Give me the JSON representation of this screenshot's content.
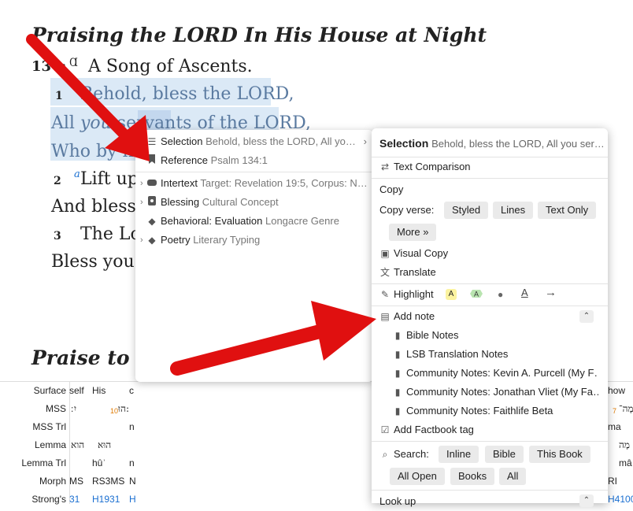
{
  "bible": {
    "heading1": "Praising the LORD In His House at Night",
    "ps_num": "134:",
    "ps_title_prefix": "Ɑ",
    "ps_title": "A Song of Ascents.",
    "v1_num": "1",
    "v1_line1": "Behold, bless the LORD,",
    "v1_line2a": "All ",
    "v1_line2b": "you",
    "v1_line2c": " servants of the LORD,",
    "v1_line3": "Who by night",
    "v2_num": "2",
    "v2_note": "a",
    "v2_line1": "Lift up",
    "v2_line2": "And bless t",
    "v3_num": "3",
    "v3_line1": "The Lo",
    "v3_line2": "Bless you fr",
    "heading2": "Praise to Go"
  },
  "interlinear": {
    "rows": [
      {
        "label": "Surface",
        "c1": "self",
        "c2": "His",
        "c3": "c",
        "cr": "how"
      },
      {
        "label": "MSS",
        "c1": "יִ ׃",
        "c2": "הוּ:",
        "c3": "",
        "cr": "מָה־"
      },
      {
        "label": "MSS Trl",
        "c1": "",
        "c2": "",
        "c3": "n",
        "cr": "ma"
      },
      {
        "label": "Lemma",
        "c1": "הוא",
        "c2": "הוּא",
        "c3": "",
        "cr": "מָה"
      },
      {
        "label": "Lemma Trl",
        "c1": "",
        "c2": "hûʾ",
        "c3": "n",
        "cr": "mâ"
      },
      {
        "label": "Morph",
        "c1": "MS",
        "c2": "RS3MS",
        "c3": "N",
        "cr": "RI"
      },
      {
        "label": "Strong's",
        "c1": "31",
        "c2": "H1931",
        "c3": "H",
        "cr": "H4100"
      }
    ],
    "small_num_1": "7",
    "small_num_2": "10",
    "small_num_3": "7"
  },
  "menu_left": {
    "items": [
      {
        "label": "Selection",
        "sub": "Behold, bless the LORD, All yo…",
        "icon": "text-lines-icon",
        "arrow": true
      },
      {
        "label": "Reference",
        "sub": "Psalm 134:1",
        "icon": "bookmark-icon",
        "arrow": false
      },
      {
        "label": "Intertext",
        "sub": "Target: Revelation 19:5, Corpus: N…",
        "icon": "tag-icon",
        "arrow": false
      },
      {
        "label": "Blessing",
        "sub": "Cultural Concept",
        "icon": "concept-icon",
        "arrow": false
      },
      {
        "label": "Behavioral: Evaluation",
        "sub": "Longacre Genre",
        "icon": "diamond-icon",
        "arrow": false
      },
      {
        "label": "Poetry",
        "sub": "Literary Typing",
        "icon": "diamond-icon",
        "arrow": false
      }
    ]
  },
  "menu_right": {
    "title": "Selection",
    "title_sub": "Behold, bless the LORD, All you ser…",
    "text_comparison": "Text Comparison",
    "copy": "Copy",
    "copy_verse": "Copy verse:",
    "copy_buttons": [
      "Styled",
      "Lines",
      "Text Only",
      "More »"
    ],
    "visual_copy": "Visual Copy",
    "translate": "Translate",
    "highlight": "Highlight",
    "add_note": "Add note",
    "notes": [
      "Bible Notes",
      "LSB Translation Notes",
      "Community Notes: Kevin A. Purcell (My F…",
      "Community Notes: Jonathan Vliet (My Fa…",
      "Community Notes: Faithlife Beta"
    ],
    "add_factbook": "Add Factbook tag",
    "search": "Search:",
    "search_buttons": [
      "Inline",
      "Bible",
      "This Book",
      "All Open",
      "Books",
      "All"
    ],
    "look_up": "Look up"
  },
  "colors": {
    "highlight_blue": "#dbe9f6",
    "arrow_red": "#e01010",
    "link_blue": "#1a6fd1"
  }
}
